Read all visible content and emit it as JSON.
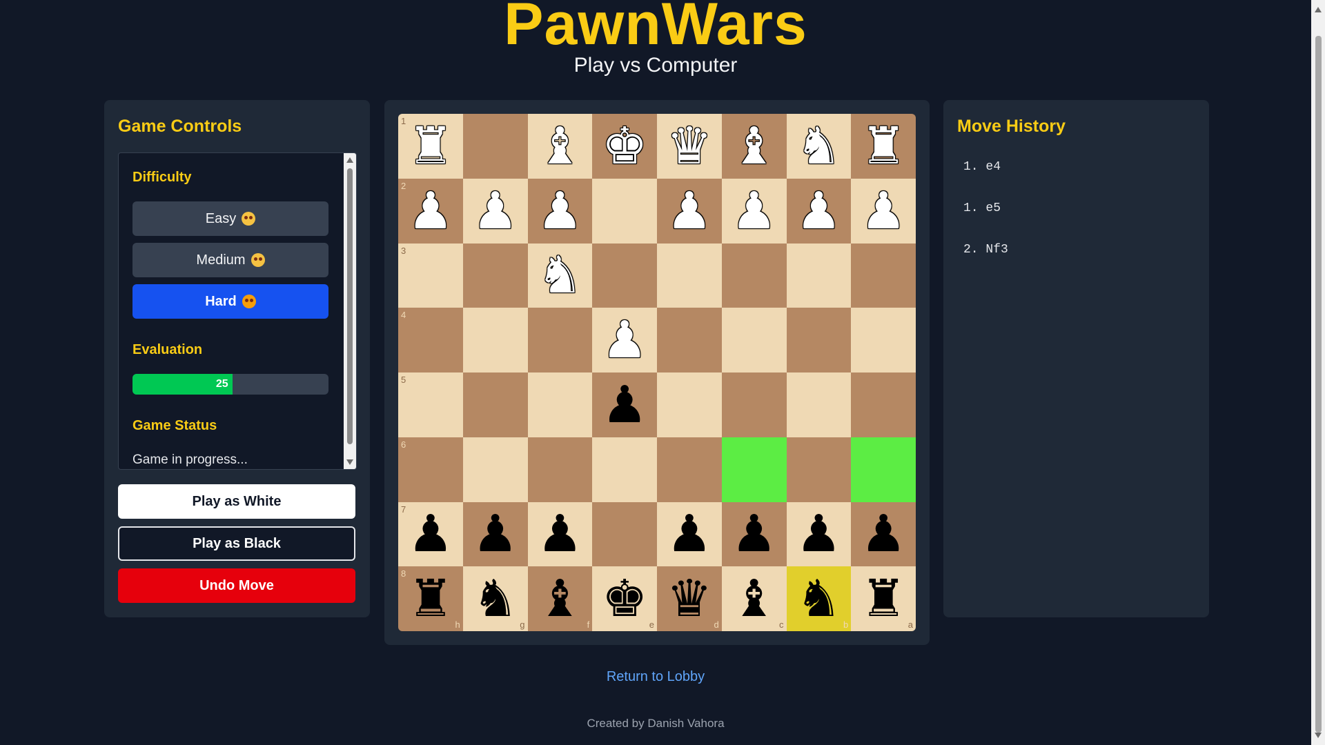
{
  "header": {
    "title": "PawnWars",
    "subtitle": "Play vs Computer"
  },
  "controls": {
    "heading": "Game Controls",
    "difficulty_label": "Difficulty",
    "difficulty_options": [
      {
        "label": "Easy",
        "icon": "dizzy-face-icon",
        "selected": false
      },
      {
        "label": "Medium",
        "icon": "eye-roll-face-icon",
        "selected": false
      },
      {
        "label": "Hard",
        "icon": "dizzy-face-icon",
        "selected": true
      }
    ],
    "evaluation_label": "Evaluation",
    "evaluation_value": "25",
    "evaluation_fill": 0.51,
    "status_label": "Game Status",
    "status_text": "Game in progress...",
    "play_white_label": "Play as White",
    "play_black_label": "Play as Black",
    "undo_label": "Undo Move"
  },
  "board": {
    "orientation": "black-bottom",
    "ranks": [
      "1",
      "2",
      "3",
      "4",
      "5",
      "6",
      "7",
      "8"
    ],
    "files": [
      "h",
      "g",
      "f",
      "e",
      "d",
      "c",
      "b",
      "a"
    ],
    "rows": [
      [
        "wR",
        "",
        "wB",
        "wK",
        "wQ",
        "wB",
        "wN",
        "wR"
      ],
      [
        "wP",
        "wP",
        "wP",
        "",
        "wP",
        "wP",
        "wP",
        "wP"
      ],
      [
        "",
        "",
        "wN",
        "",
        "",
        "",
        "",
        ""
      ],
      [
        "",
        "",
        "",
        "wP",
        "",
        "",
        "",
        ""
      ],
      [
        "",
        "",
        "",
        "bP",
        "",
        "",
        "",
        ""
      ],
      [
        "",
        "",
        "",
        "",
        "",
        "",
        "",
        ""
      ],
      [
        "bP",
        "bP",
        "bP",
        "",
        "bP",
        "bP",
        "bP",
        "bP"
      ],
      [
        "bR",
        "bN",
        "bB",
        "bK",
        "bQ",
        "bB",
        "bN",
        "bR"
      ]
    ],
    "highlights": {
      "selected": "b8",
      "targets": [
        "c6",
        "a6"
      ]
    },
    "colors": {
      "light": "#efd9b4",
      "dark": "#b58863",
      "target": "#5ced44",
      "selected": "#e1cf2c"
    }
  },
  "history": {
    "heading": "Move History",
    "moves": [
      "1. e4",
      "1. e5",
      "2. Nf3"
    ]
  },
  "footer": {
    "lobby_link": "Return to Lobby",
    "credit": "Created by Danish Vahora"
  }
}
